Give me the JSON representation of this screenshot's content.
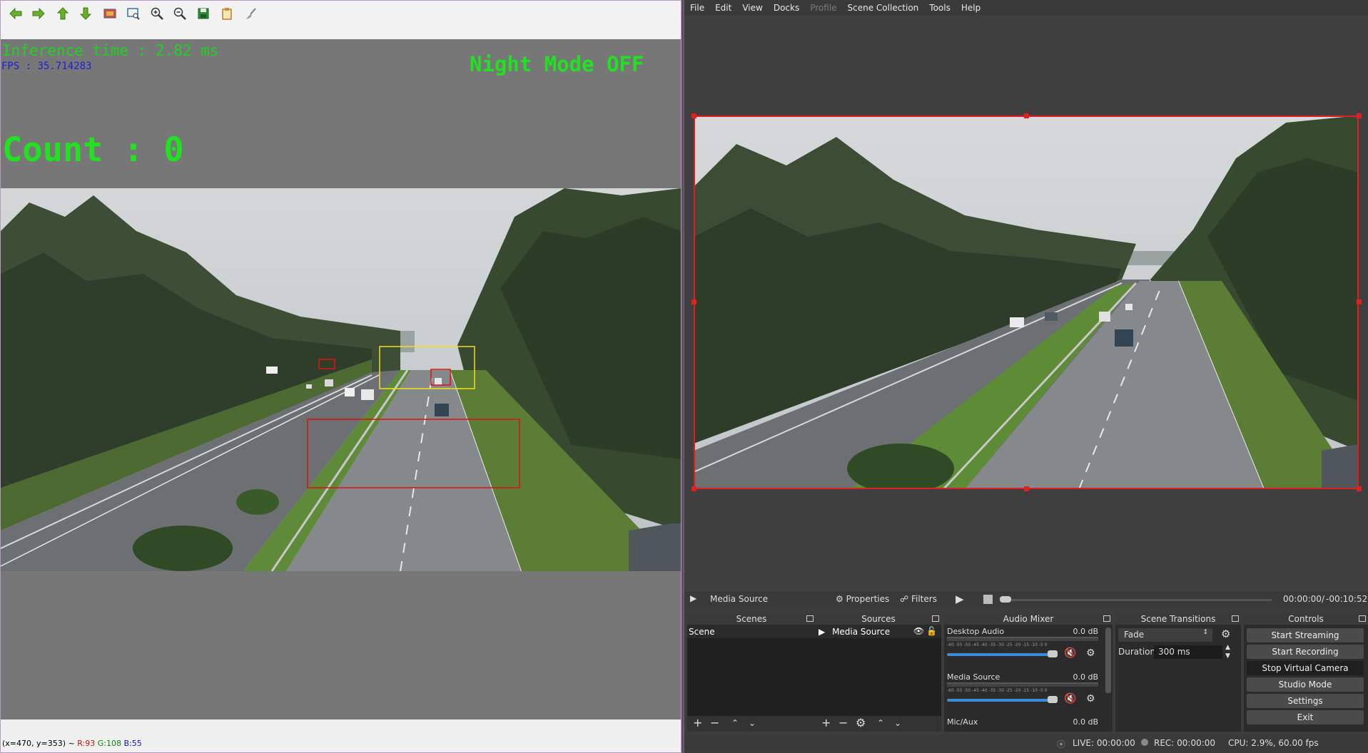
{
  "cv_window": {
    "toolbar": {
      "buttons": [
        "arrow-left-icon",
        "arrow-right-icon",
        "arrow-up-icon",
        "arrow-down-icon",
        "image-icon",
        "zoom-area-icon",
        "zoom-in-icon",
        "zoom-out-icon",
        "save-icon",
        "clipboard-icon",
        "brush-icon"
      ]
    },
    "overlay": {
      "inference_time": "Inference time : 2.82 ms",
      "fps": "FPS : 35.714283",
      "night_mode": "Night Mode OFF",
      "count": "Count : 0"
    },
    "status": {
      "coords": "(x=470, y=353) ~ ",
      "r": "R:93",
      "g": "G:108",
      "b": "B:55"
    },
    "colors": {
      "text_green": "#22e022",
      "fps_blue": "#1f1fd8",
      "box_red": "#e01010",
      "box_yellow": "#f0e020"
    }
  },
  "obs": {
    "menu": [
      "File",
      "Edit",
      "View",
      "Docks",
      "Profile",
      "Scene Collection",
      "Tools",
      "Help"
    ],
    "menu_disabled": "Profile",
    "media_bar": {
      "source_name": "Media Source",
      "properties_label": "Properties",
      "filters_label": "Filters",
      "time_current": "00:00:00",
      "time_sep": "/",
      "time_remaining": "-00:10:52"
    },
    "scenes": {
      "title": "Scenes",
      "items": [
        "Scene"
      ]
    },
    "sources": {
      "title": "Sources",
      "items": [
        "Media Source"
      ]
    },
    "audio_mixer": {
      "title": "Audio Mixer",
      "channels": [
        {
          "name": "Desktop Audio",
          "level": "0.0 dB"
        },
        {
          "name": "Media Source",
          "level": "0.0 dB"
        },
        {
          "name": "Mic/Aux",
          "level": "0.0 dB"
        }
      ],
      "scale": "-60 -55 -50 -45 -40 -35 -30 -25 -20 -15 -10 -5 0"
    },
    "transitions": {
      "title": "Scene Transitions",
      "selected": "Fade",
      "duration_label": "Duration",
      "duration_value": "300 ms"
    },
    "controls": {
      "title": "Controls",
      "buttons": [
        "Start Streaming",
        "Start Recording",
        "Stop Virtual Camera",
        "Studio Mode",
        "Settings",
        "Exit"
      ]
    },
    "status": {
      "live": "LIVE: 00:00:00",
      "rec": "REC: 00:00:00",
      "cpu": "CPU: 2.9%, 60.00 fps"
    },
    "colors": {
      "selection_red": "#e02020",
      "slider_blue": "#3a8ed8",
      "mute_red": "#d02020"
    }
  }
}
